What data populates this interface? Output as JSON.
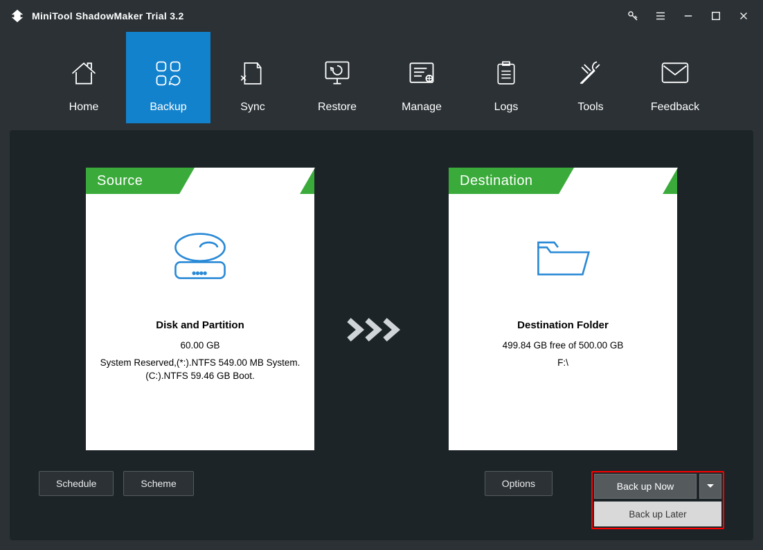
{
  "app_title": "MiniTool ShadowMaker Trial 3.2",
  "nav": [
    {
      "label": "Home"
    },
    {
      "label": "Backup"
    },
    {
      "label": "Sync"
    },
    {
      "label": "Restore"
    },
    {
      "label": "Manage"
    },
    {
      "label": "Logs"
    },
    {
      "label": "Tools"
    },
    {
      "label": "Feedback"
    }
  ],
  "source": {
    "header": "Source",
    "title": "Disk and Partition",
    "size": "60.00 GB",
    "details": "System Reserved,(*:).NTFS 549.00 MB System. (C:).NTFS 59.46 GB Boot."
  },
  "destination": {
    "header": "Destination",
    "title": "Destination Folder",
    "size": "499.84 GB free of 500.00 GB",
    "path": "F:\\"
  },
  "footer": {
    "schedule": "Schedule",
    "scheme": "Scheme",
    "options": "Options",
    "backup_now": "Back up Now",
    "backup_later": "Back up Later"
  }
}
